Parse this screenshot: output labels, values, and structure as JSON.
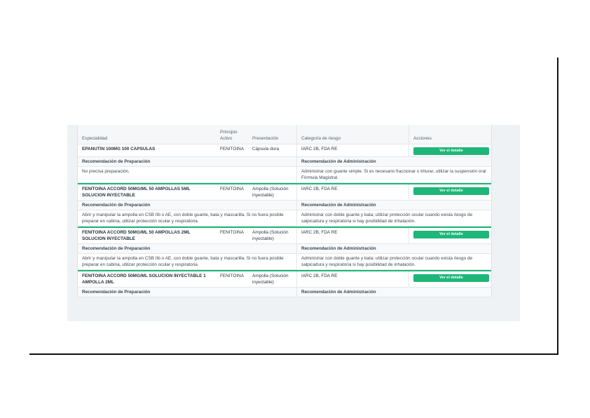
{
  "table": {
    "headers": {
      "especialidad": "Especialidad",
      "principio_activo": "Principio Activo",
      "presentacion": "Presentación",
      "categoria": "Categoría de riesgo",
      "acciones": "Acciones"
    },
    "prep_header": "Recomendación de Preparación",
    "admin_header": "Recomendación de Administración",
    "button_label": "Ver el detalle",
    "rows": [
      {
        "especialidad": "EPANUTIN 100MG 100 CAPSULAS",
        "principio_activo": "FENITOINA",
        "presentacion": "Cápsula dura",
        "categoria": "IARC 2B, FDA RE",
        "preparacion": "No precisa preparación.",
        "administracion": "Administrar con guante simple. Si es necesario fraccionar o triturar, utilizar la suspensión oral Fórmula Magistral."
      },
      {
        "especialidad": "FENITOINA ACCORD 50MG/ML 50 AMPOLLAS 5ML SOLUCION INYECTABLE",
        "principio_activo": "FENITOINA",
        "presentacion": "Ampolla (Solución inyectable)",
        "categoria": "IARC 2B, FDA RE",
        "preparacion": "Abrir y manipular la ampolla en CSB IIb o AE, con doble guante, bata y mascarilla. Si no fuera posible preparar en cabina, utilizar protección ocular y respiratoria.",
        "administracion": "Administrar con doble guante y bata; utilizar protección ocular cuando exista riesgo de salpicadura y respiratoria si hay posibilidad de inhalación."
      },
      {
        "especialidad": "FENITOINA ACCORD 50MG/ML 50 AMPOLLAS 2ML SOLUCION INYECTABLE",
        "principio_activo": "FENITOINA",
        "presentacion": "Ampolla (Solución inyectable)",
        "categoria": "IARC 2B, FDA RE",
        "preparacion": "Abrir y manipular la ampolla en CSB IIb o AE, con doble guante, bata y mascarilla. Si no fuera posible preparar en cabina, utilizar protección ocular y respiratoria.",
        "administracion": "Administrar con doble guante y bata; utilizar protección ocular cuando exista riesgo de salpicadura y respiratoria si hay posibilidad de inhalación."
      },
      {
        "especialidad": "FENITOINA ACCORD 50MG/ML SOLUCION INYECTABLE 1 AMPOLLA 2ML",
        "principio_activo": "FENITOINA",
        "presentacion": "Ampolla (Solución inyectable)",
        "categoria": "IARC 2B, FDA RE"
      }
    ]
  },
  "colors": {
    "accent": "#1fb679",
    "frame": "#111111",
    "panel_bg": "#eef2f5"
  }
}
